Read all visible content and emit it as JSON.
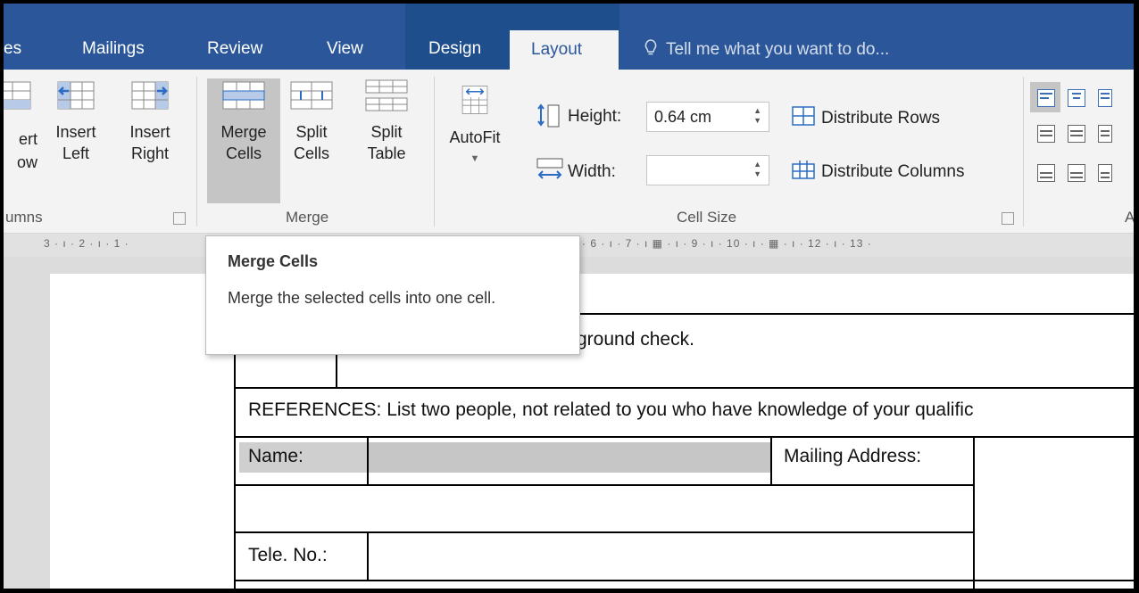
{
  "tabs": [
    {
      "label": "es"
    },
    {
      "label": "Mailings"
    },
    {
      "label": "Review"
    },
    {
      "label": "View"
    },
    {
      "label": "Design"
    },
    {
      "label": "Layout"
    }
  ],
  "tell_me": "Tell me what you want to do...",
  "ribbon": {
    "rows_columns": {
      "insert_row_partial": [
        "ert",
        "ow"
      ],
      "insert_left": [
        "Insert",
        "Left"
      ],
      "insert_right": [
        "Insert",
        "Right"
      ],
      "group_label": "umns"
    },
    "merge": {
      "merge_cells": [
        "Merge",
        "Cells"
      ],
      "split_cells": [
        "Split",
        "Cells"
      ],
      "split_table": [
        "Split",
        "Table"
      ],
      "group_label": "Merge"
    },
    "cell_size": {
      "autofit": "AutoFit",
      "height_label": "Height:",
      "height_value": "0.64 cm",
      "width_label": "Width:",
      "width_value": "",
      "distribute_rows": "Distribute Rows",
      "distribute_columns": "Distribute Columns",
      "group_label": "Cell Size"
    },
    "alignment": {
      "group_label_partial": "A"
    }
  },
  "ruler": {
    "left_marks": "3 · ı · 2 · ı · 1 ·",
    "right_marks": "5 · ı · 6 · ı · 7 · ı  ▦  · ı · 9 · ı · 10 · ı · ▦ · ı · 12 · ı · 13 ·"
  },
  "tooltip": {
    "title": "Merge Cells",
    "body": "Merge the selected cells into one cell."
  },
  "document": {
    "row_background_check": "ground check.",
    "references": "REFERENCES: List two people, not related to you who have knowledge of your qualific",
    "name_label": "Name:",
    "mailing_address_label": "Mailing Address:",
    "tele_label": "Tele. No.:"
  },
  "colors": {
    "tab_bar": "#2b579a",
    "design_zone": "#1e4e8c",
    "ribbon_bg": "#f3f3f3",
    "selected_button": "#c5c5c5",
    "cell_shading": "#c6c6c6"
  }
}
